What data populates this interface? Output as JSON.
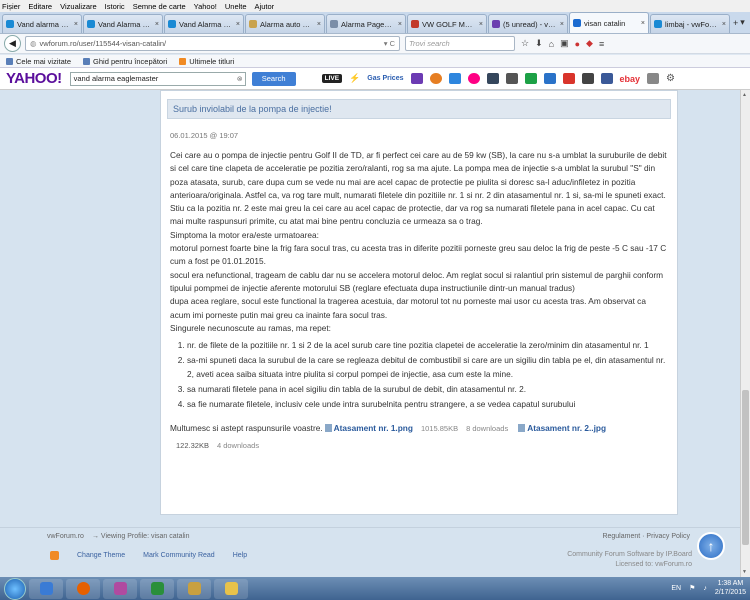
{
  "menu": [
    "Fișier",
    "Editare",
    "Vizualizare",
    "Istoric",
    "Semne de carte",
    "Yahoo!",
    "Unelte",
    "Ajutor"
  ],
  "tabs": [
    {
      "label": "Vand alarma vip...",
      "color": "#1a8ad4"
    },
    {
      "label": "Vand Alarma au...",
      "color": "#1a8ad4"
    },
    {
      "label": "Vand Alarma au...",
      "color": "#1a8ad4"
    },
    {
      "label": "Alarma auto vip...",
      "color": "#c9a34e"
    },
    {
      "label": "Alarma Pager Vi...",
      "color": "#7b8ea8"
    },
    {
      "label": "VW GOLF MK2 ...",
      "color": "#c23a2a"
    },
    {
      "label": "(5 unread) - visa...",
      "color": "#6b3fb0"
    },
    {
      "label": "visan catalin",
      "color": "#1a6ad0"
    },
    {
      "label": "limbaj - vwForu...",
      "color": "#1a8ad4"
    }
  ],
  "nav": {
    "url": "vwforum.ro/user/115544-visan-catalin/",
    "search_placeholder": "Trovi search"
  },
  "bookmarks": [
    "Cele mai vizitate",
    "Ghid pentru începători",
    "Ultimele titluri"
  ],
  "yahoo": {
    "logo": "YAHOO!",
    "query": "vand alarma eaglemaster",
    "search_btn": "Search",
    "live": "LIVE",
    "gas": "Gas Prices",
    "ebay": "ebay"
  },
  "post": {
    "title": "Surub inviolabil de la pompa de injectie!",
    "date": "06.01.2015 @ 19:07",
    "p1": "Cei care au o pompa de injectie pentru Golf II de TD, ar fi perfect cei care au de 59 kw (SB), la care nu s-a umblat la suruburile de debit si cel care tine clapeta de acceleratie pe pozitia zero/ralanti, rog sa ma ajute. La pompa mea de injectie s-a umblat la surubul \"S\" din poza atasata, surub, care dupa cum se vede nu mai are acel capac de protectie pe piulita si doresc sa-l aduc/infiletez in pozitia anterioara/originala. Astfel ca, va rog tare mult, numarati filetele din pozitiile nr. 1 si nr. 2 din atasamentul nr. 1 si, sa-mi le spuneti exact. Stiu ca la pozitia nr. 2 este mai greu la cei care au acel capac de protectie, dar va rog sa numarati filetele pana in acel capac. Cu cat mai multe raspunsuri primite, cu atat mai bine pentru concluzia ce urmeaza sa o trag.",
    "p2": "Simptoma la motor era/este urmatoarea:",
    "p3": "motorul pornest foarte bine la frig fara socul tras, cu acesta tras in diferite pozitii porneste greu sau deloc la frig de peste -5 C sau -17 C cum a fost pe 01.01.2015.",
    "p4": "socul era nefunctional, trageam de cablu dar nu se accelera motorul deloc. Am reglat socul si ralantiul prin sistemul de parghii conform tipului pompmei de injectie aferente motorului SB (reglare efectuata dupa instructiunile dintr-un manual tradus)",
    "p5": "dupa acea reglare, socul este functional la tragerea acestuia, dar motorul tot nu porneste mai usor cu acesta tras. Am observat ca acum imi porneste putin mai greu ca inainte fara socul tras.",
    "p6": "Singurele necunoscute au ramas, ma repet:",
    "items": [
      "nr. de filete de la pozitiile nr. 1 si 2 de la acel surub care tine pozitia clapetei de acceleratie la zero/minim din atasamentul nr. 1",
      "sa-mi spuneti daca la surubul de la care se regleaza debitul de combustibil si care are un sigiliu din tabla pe el, din atasamentul nr. 2, aveti acea saiba situata intre piulita si corpul pompei de injectie, asa cum este la mine.",
      "sa numarati filetele pana in acel sigiliu din tabla de la surubul de debit, din atasamentul nr. 2.",
      "sa fie numarate filetele, inclusiv cele unde intra surubelnita pentru strangere, a se vedea capatul surubului"
    ],
    "thanks": "Multumesc si astept raspunsurile voastre.",
    "att1": "Atasament nr. 1.png",
    "att1_size": "1015.85KB",
    "att1_dl": "8 downloads",
    "att2": "Atasament nr. 2..jpg",
    "att2_size": "122.32KB",
    "att2_dl": "4 downloads"
  },
  "footer": {
    "site": "vwForum.ro",
    "crumb": "→ Viewing Profile: visan catalin",
    "reg": "Regulament",
    "privacy": "Privacy Policy",
    "change_theme": "Change Theme",
    "mark_read": "Mark Community Read",
    "help": "Help",
    "powered1": "Community Forum Software by IP.Board",
    "powered2": "Licensed to: vwForum.ro"
  },
  "taskbar": {
    "lang": "EN",
    "time": "1:38 AM",
    "date": "2/17/2015"
  }
}
